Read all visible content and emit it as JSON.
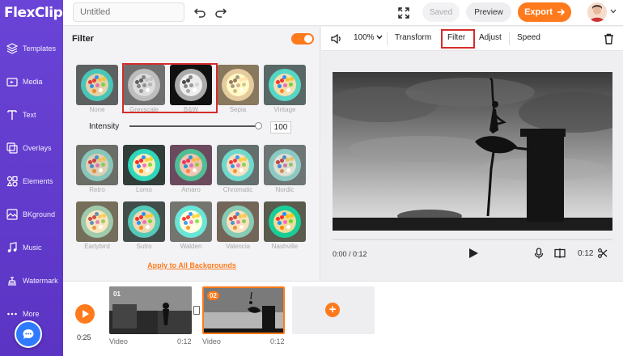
{
  "app": {
    "logo": "FlexClip"
  },
  "sidebar": {
    "items": [
      {
        "label": "Templates",
        "icon": "layers-icon"
      },
      {
        "label": "Media",
        "icon": "media-icon"
      },
      {
        "label": "Text",
        "icon": "text-icon"
      },
      {
        "label": "Overlays",
        "icon": "overlays-icon"
      },
      {
        "label": "Elements",
        "icon": "elements-icon"
      },
      {
        "label": "BKground",
        "icon": "background-icon"
      },
      {
        "label": "Music",
        "icon": "music-icon"
      },
      {
        "label": "Watermark",
        "icon": "watermark-icon"
      },
      {
        "label": "More",
        "icon": "more-icon"
      }
    ]
  },
  "topbar": {
    "title_placeholder": "Untitled",
    "saved_label": "Saved",
    "preview_label": "Preview",
    "export_label": "Export"
  },
  "filter_panel": {
    "title": "Filter",
    "toggle_on": true,
    "intensity_label": "Intensity",
    "intensity_value": "100",
    "apply_label": "Apply to All Backgrounds",
    "filters": [
      {
        "name": "None"
      },
      {
        "name": "Greyscale"
      },
      {
        "name": "B&W"
      },
      {
        "name": "Sepia"
      },
      {
        "name": "Vintage"
      },
      {
        "name": "Retro"
      },
      {
        "name": "Lomo"
      },
      {
        "name": "Amaro"
      },
      {
        "name": "Chromatic"
      },
      {
        "name": "Nordic"
      },
      {
        "name": "Earlybird"
      },
      {
        "name": "Sutro"
      },
      {
        "name": "Walden"
      },
      {
        "name": "Valencia"
      },
      {
        "name": "Nashville"
      }
    ]
  },
  "preview_toolbar": {
    "zoom": "100%",
    "tabs": {
      "transform": "Transform",
      "filter": "Filter",
      "adjust": "Adjust",
      "speed": "Speed"
    }
  },
  "player": {
    "time_current": "0:00 / 0:12",
    "duration": "0:12"
  },
  "timeline": {
    "total_time": "0:25",
    "clips": [
      {
        "badge": "01",
        "label": "Video",
        "duration": "0:12"
      },
      {
        "badge": "02",
        "label": "Video",
        "duration": "0:12"
      }
    ]
  },
  "colors": {
    "accent": "#fe7a1c",
    "sidebar": "#5b34c4",
    "highlight": "#d42c2c"
  }
}
